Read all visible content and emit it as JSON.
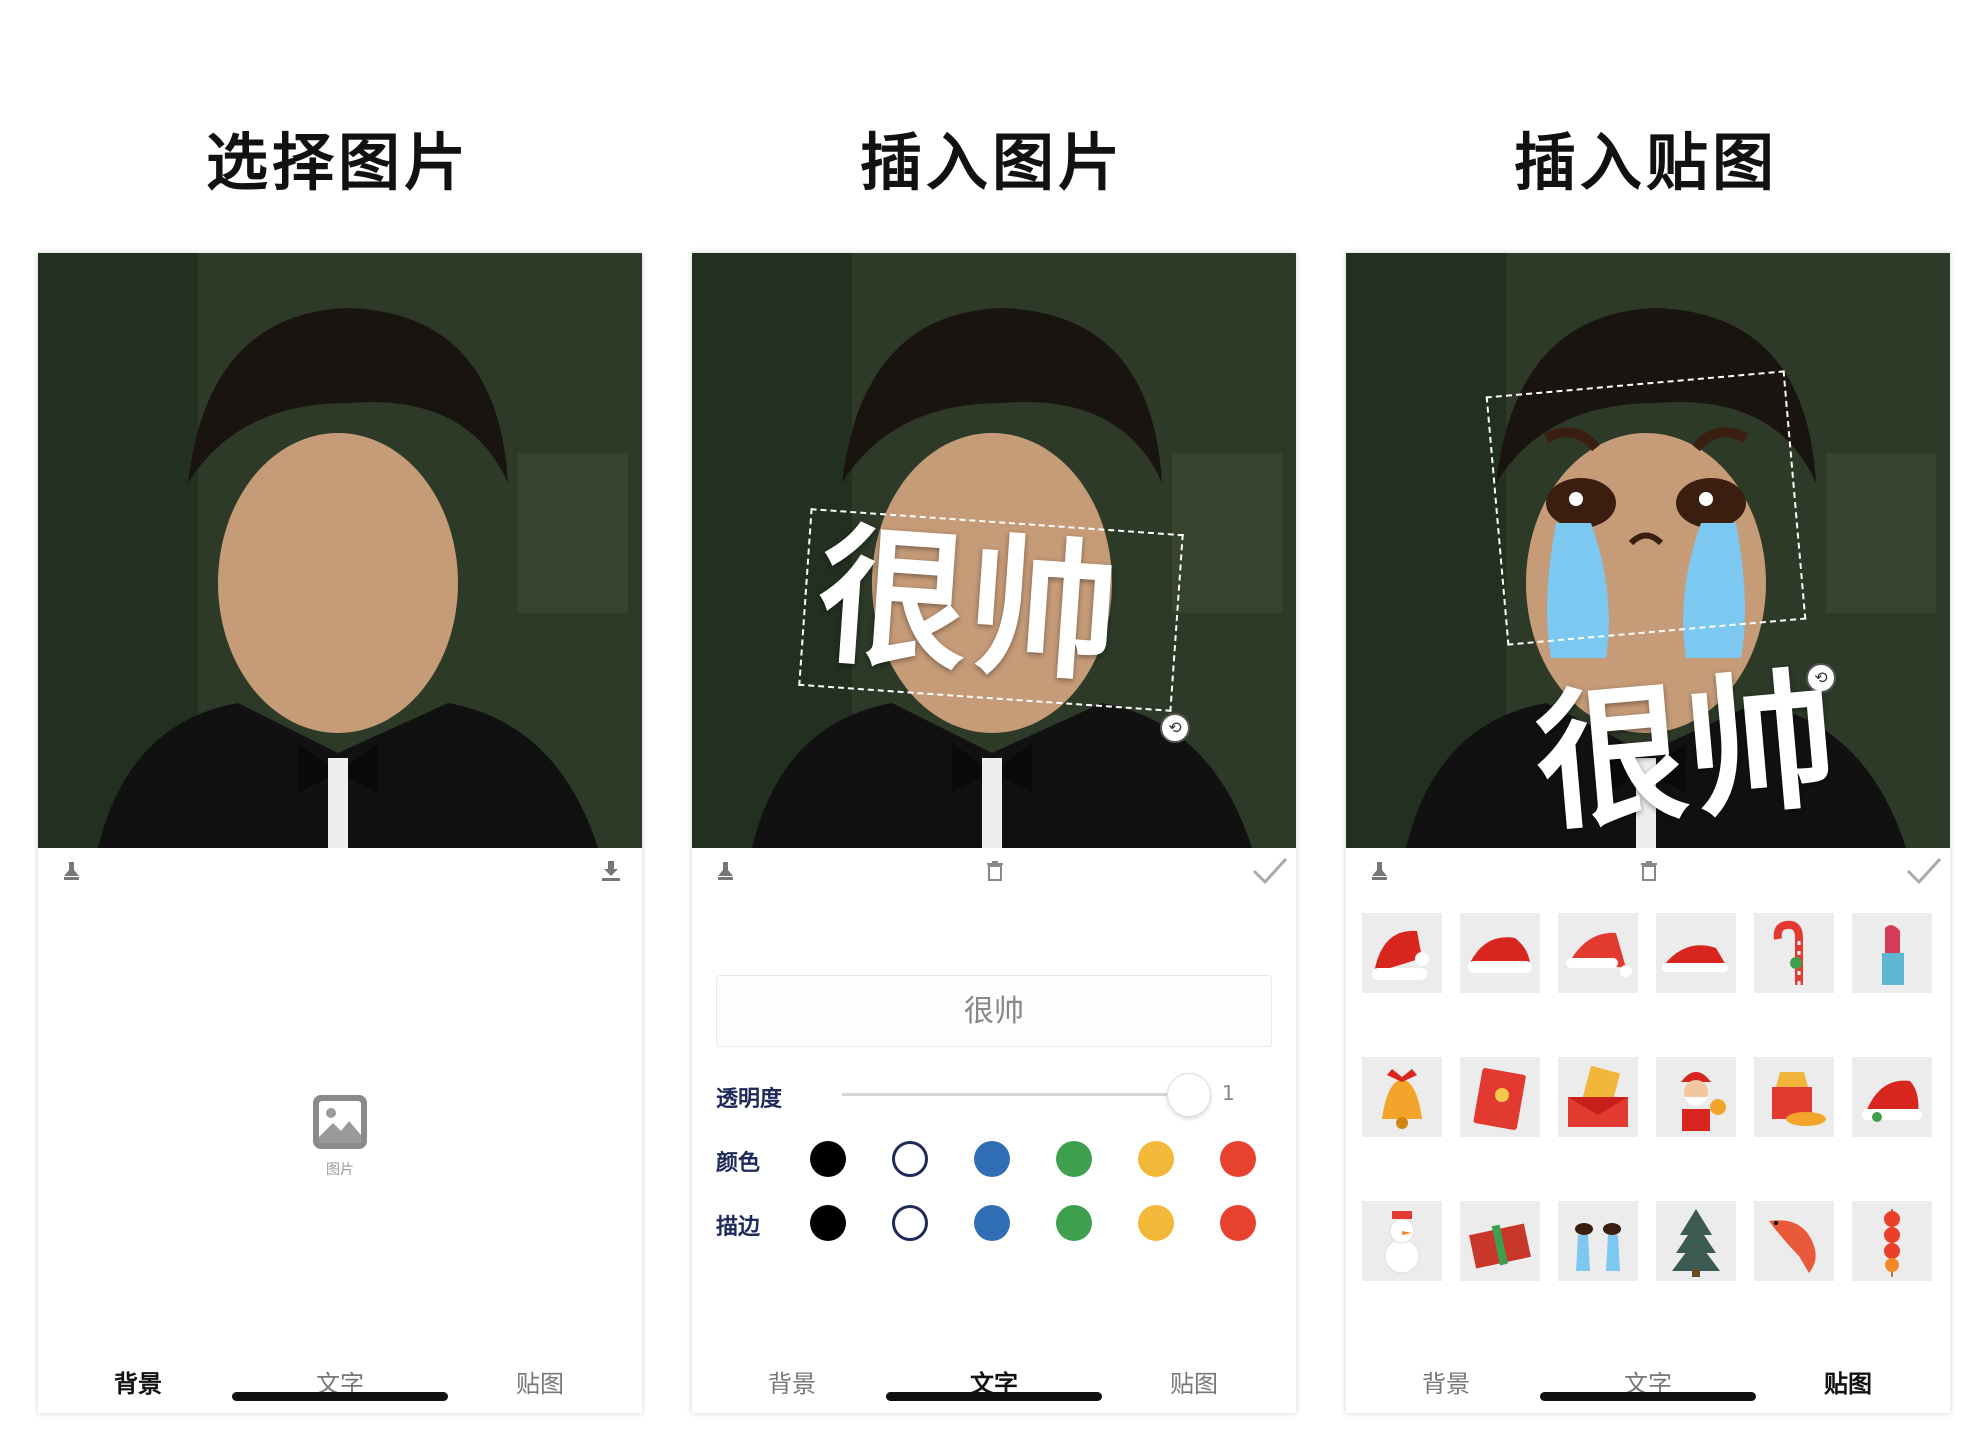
{
  "panels": [
    {
      "title": "选择图片"
    },
    {
      "title": "插入图片"
    },
    {
      "title": "插入贴图"
    }
  ],
  "tabs": {
    "background": "背景",
    "text": "文字",
    "sticker": "贴图"
  },
  "panel1": {
    "placeholder_label": "图片"
  },
  "panel2": {
    "overlay_text": "很帅",
    "input_value": "很帅",
    "opacity_label": "透明度",
    "opacity_value": "1",
    "color_label": "颜色",
    "stroke_label": "描边",
    "palette": [
      "#000000",
      "#ffffff",
      "#2f6db5",
      "#3ea04f",
      "#f1b83a",
      "#e8412f"
    ],
    "selected_color": "#ffffff"
  },
  "panel3": {
    "overlay_text": "很帅",
    "stickers": [
      "santa-hat",
      "santa-hat",
      "santa-hat",
      "santa-hat",
      "candy-cane",
      "lipstick",
      "christmas-bell",
      "red-envelope",
      "red-envelope-open",
      "santa-claus",
      "gold-ingot",
      "santa-hat",
      "snowman",
      "gift-box",
      "crying-eyes",
      "christmas-tree",
      "koi-fish",
      "candied-hawthorn"
    ]
  },
  "colors": {
    "accent": "#1d2a5a",
    "photo_bg": "#2d3a27"
  }
}
